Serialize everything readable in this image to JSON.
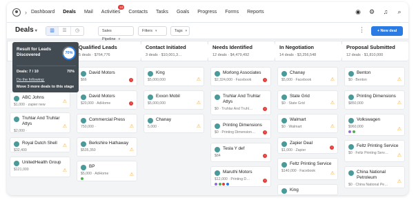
{
  "nav": {
    "items": [
      "Dashboard",
      "Deals",
      "Mail",
      "Activities",
      "Contacts",
      "Tasks",
      "Goals",
      "Progress",
      "Forms",
      "Reports"
    ],
    "active": "Deals",
    "activities_badge": "10"
  },
  "toolbar": {
    "title": "Deals",
    "pipeline": "Sales Pipeline",
    "filters": "Filters",
    "tags": "Tags",
    "new_deal": "+ New deal"
  },
  "tooltip": {
    "title": "Result for Leads Discovered",
    "percent": "70%",
    "deals": "Deals: 7 / 10",
    "deals_pct": "70%",
    "link": "Do the following:",
    "action": "Move 3 more deals to this stage"
  },
  "columns": [
    {
      "name": "",
      "meta": "",
      "cards": [
        {
          "name": "ABC Johns",
          "meta": "$1,000  ·  zapier new",
          "flag": "warn"
        },
        {
          "name": "Truhlar And Truhlar Attys",
          "meta": "$2,000  ·",
          "flag": "warn"
        },
        {
          "name": "Royal Dutch Shell",
          "meta": "$32,400",
          "flag": "warn"
        },
        {
          "name": "UnitedHealth Group",
          "meta": "$121,000",
          "flag": "warn"
        }
      ]
    },
    {
      "name": "Qualified Leads",
      "meta": "5 deals  ·  $764,776",
      "cards": [
        {
          "name": "David Motors",
          "meta": "$66",
          "flag": "red"
        },
        {
          "name": "David Motors",
          "meta": "$20,000  ·  AdHome",
          "flag": "red"
        },
        {
          "name": "Commercial Press",
          "meta": "750,000  ·",
          "flag": "warn"
        },
        {
          "name": "Berkshire Hathaway",
          "meta": "$535,350",
          "flag": "warn"
        },
        {
          "name": "BP",
          "meta": "$5,000  ·  AdHome",
          "flag": "warn",
          "greendot": true
        }
      ]
    },
    {
      "name": "Contact Initiated",
      "meta": "3 deals  ·  $10,001,3…",
      "cards": [
        {
          "name": "King",
          "meta": "$5,000,000",
          "flag": "warn"
        },
        {
          "name": "Exxon Mobil",
          "meta": "$5,000,000",
          "flag": "warn"
        },
        {
          "name": "Chanay",
          "meta": "5,000  ·",
          "flag": "warn"
        }
      ]
    },
    {
      "name": "Needs Identified",
      "meta": "12 deals  ·  $4,479,492",
      "cards": [
        {
          "name": "Morlong Associates",
          "meta": "$2,324,000  ·  Facebook",
          "flag": "red"
        },
        {
          "name": "Truhlar And Truhlar Attys",
          "meta": "$0  ·  Truhlar And Truhl…",
          "flag": "red"
        },
        {
          "name": "Printing Dimensions",
          "meta": "$0  ·  Printing Dimension…",
          "flag": "red"
        },
        {
          "name": "Tesla Y def",
          "meta": "$84",
          "flag": "red"
        },
        {
          "name": "Maruthi Motors",
          "meta": "$12,000  ·  Printing D…",
          "flag": "red",
          "dots": [
            "#8e6bd9",
            "#4caf50",
            "#e53935",
            "#2a7be4"
          ]
        }
      ]
    },
    {
      "name": "In Negotiation",
      "meta": "14 deals  ·  $3,256,548",
      "cards": [
        {
          "name": "Chanay",
          "meta": "$5,000  ·  Facebook",
          "flag": "warn"
        },
        {
          "name": "State Grid",
          "meta": "$0  ·  State Grid",
          "flag": "warn"
        },
        {
          "name": "Walmart",
          "meta": "$0  ·  Walmart",
          "flag": "warn"
        },
        {
          "name": "Zapier Deal",
          "meta": "$1,000  ·  Zapier",
          "flag": "red"
        },
        {
          "name": "Feltz Printing Service",
          "meta": "$140,000  ·  Facebook",
          "flag": "warn"
        },
        {
          "name": "King",
          "meta": "",
          "flag": ""
        }
      ]
    },
    {
      "name": "Proposal Submitted",
      "meta": "12 deals  ·  $1,810,000",
      "cards": [
        {
          "name": "Benton",
          "meta": "$0  ·  Benton",
          "flag": "warn"
        },
        {
          "name": "Printing Dimensions",
          "meta": "$850,000",
          "flag": "warn"
        },
        {
          "name": "Volkswagen",
          "meta": "$960,000",
          "flag": "warn",
          "dots": [
            "#8e6bd9",
            "#4caf50"
          ]
        },
        {
          "name": "Feltz Printing Service",
          "meta": "$0  ·  Feltz Printing Serv…",
          "flag": "warn"
        },
        {
          "name": "China National Petroleum",
          "meta": "$0  ·  China National Pe…",
          "flag": "warn"
        }
      ]
    }
  ]
}
